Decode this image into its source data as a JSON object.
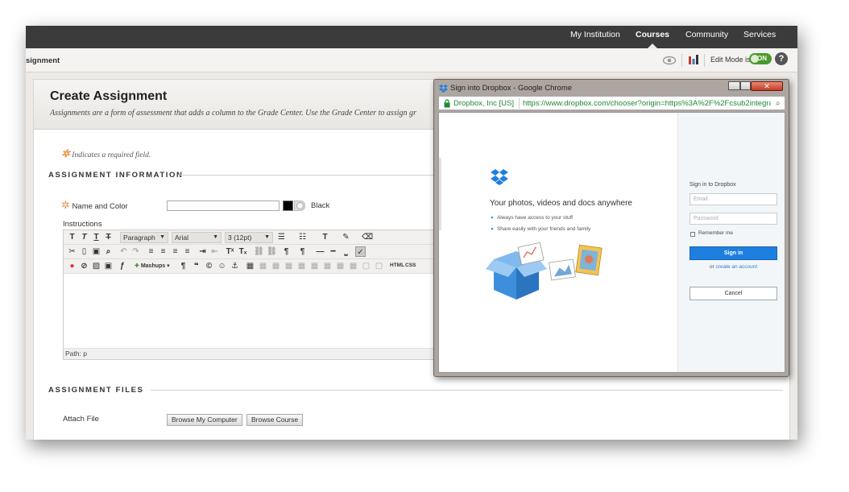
{
  "topnav": {
    "items": [
      {
        "label": "My Institution",
        "active": false
      },
      {
        "label": "Courses",
        "active": true
      },
      {
        "label": "Community",
        "active": false
      },
      {
        "label": "Services",
        "active": false
      }
    ]
  },
  "breadcrumb": {
    "text": "signment"
  },
  "editmode": {
    "label": "Edit Mode is:",
    "state": "ON"
  },
  "page": {
    "title": "Create Assignment",
    "description": "Assignments are a form of assessment that adds a column to the Grade Center. Use the Grade Center to assign gr"
  },
  "required_note": "Indicates a required field.",
  "sections": {
    "info": "ASSIGNMENT INFORMATION",
    "files": "ASSIGNMENT FILES"
  },
  "name_field": {
    "label": "Name and Color",
    "value": "",
    "color_name": "Black",
    "color_hex": "#000000"
  },
  "instructions": {
    "label": "Instructions",
    "format_select": "Paragraph",
    "font_select": "Arial",
    "size_select": "3 (12pt)",
    "mashups_label": "Mashups",
    "html_label": "HTML",
    "css_label": "CSS",
    "path_label": "Path: p"
  },
  "attach": {
    "label": "Attach File",
    "browse_computer": "Browse My Computer",
    "browse_course": "Browse Course"
  },
  "popup": {
    "title": "Sign into Dropbox - Google Chrome",
    "secure_label": "Dropbox, Inc [US]",
    "url": "https://www.dropbox.com/chooser?origin=https%3A%2F%2Fcsub2integra",
    "tagline": "Your photos, videos and docs anywhere",
    "features": [
      "Always have access to your stuff",
      "Share easily with your friends and family"
    ],
    "signin_title": "Sign in to Dropbox",
    "email_placeholder": "Email",
    "password_placeholder": "Password",
    "remember_label": "Remember me",
    "signin_button": "Sign in",
    "create_prefix": "or",
    "create_link": "create an account",
    "cancel_button": "Cancel"
  },
  "colors": {
    "nav_bg": "#3b3b3b",
    "toggle_on": "#4a9a2a",
    "required_star": "#e8934a",
    "dropbox_blue": "#1f7fe0",
    "secure_green": "#1e8a32"
  }
}
